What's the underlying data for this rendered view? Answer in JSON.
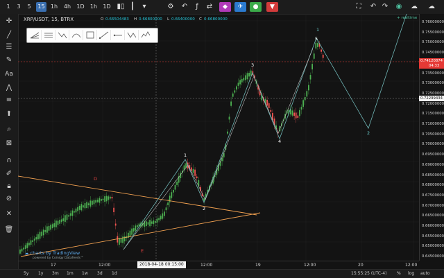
{
  "toolbar": {
    "timeframes": [
      "1",
      "3",
      "5",
      "15",
      "1h",
      "4h",
      "1D",
      "1h",
      "1D"
    ],
    "active_timeframe_index": 3,
    "colors": {
      "purple": "#b03ab8",
      "blue": "#2b7bd0",
      "green": "#3bab4a",
      "red": "#d23b3b"
    }
  },
  "legend": {
    "title": "XRP/USDT, 15, BTRX",
    "o_key": "O",
    "o_val": "0.66504483",
    "h_key": "H",
    "h_val": "0.66800000",
    "l_key": "L",
    "l_val": "0.66400000",
    "c_key": "C",
    "c_val": "0.66800000"
  },
  "price_axis": {
    "labels": [
      "0.76000000",
      "0.75500000",
      "0.75000000",
      "0.74500000",
      "0.73500000",
      "0.73000000",
      "0.72500000",
      "0.72000000",
      "0.71500000",
      "0.71000000",
      "0.70500000",
      "0.70000000",
      "0.69500000",
      "0.69000000",
      "0.68500000",
      "0.68000000",
      "0.67500000",
      "0.67000000",
      "0.66500000",
      "0.66000000",
      "0.65500000",
      "0.65000000",
      "0.64500000"
    ],
    "current_price": "0.74120874",
    "current_countdown": "04:33",
    "crosshair_price": "0.72299434",
    "realtime_label": "+ realtime"
  },
  "time_axis": {
    "labels": [
      "17",
      "12:00",
      "12:00",
      "19",
      "12:00",
      "20",
      "12:00"
    ],
    "crosshair_time": "2018-04-18 00:15:00"
  },
  "waves": {
    "labels": [
      "1",
      "2",
      "3",
      "4",
      "5",
      "1",
      "2",
      "D",
      "E"
    ]
  },
  "watermark": {
    "main": "charts by TradingView",
    "sub": "powered by Coinigy Datafeeds™"
  },
  "bottombar": {
    "ranges": [
      "5y",
      "1y",
      "3m",
      "1m",
      "1w",
      "3d",
      "1d"
    ],
    "clock": "15:55:25 (UTC-4)",
    "percent": "%",
    "log": "log",
    "auto": "auto"
  }
}
